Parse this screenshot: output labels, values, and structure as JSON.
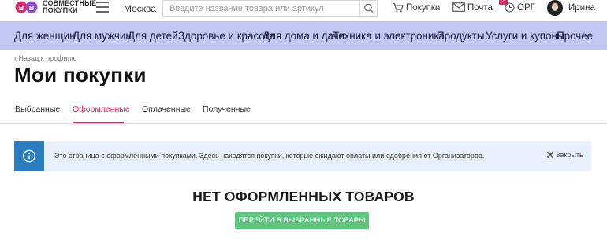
{
  "header": {
    "logo_line1": "СОВМЕСТНЫЕ",
    "logo_line2": "ПОКУПКИ",
    "city": "Москва",
    "search_placeholder": "Введите название товара или артикул",
    "links": {
      "purchases": "Покупки",
      "mail": "Почта",
      "org": "ОРГ",
      "org_badge": "2",
      "user": "Ирина"
    },
    "icons": {
      "logo": "sp-logo-icon",
      "menu": "menu-icon",
      "search": "search-icon",
      "cart": "cart-icon",
      "mail": "mail-icon",
      "org": "clock-icon"
    }
  },
  "categories": [
    "Для женщин",
    "Для мужчин",
    "Для детей",
    "Здоровье и красота",
    "Для дома и дачи",
    "Техника и электроника",
    "Продукты",
    "Услуги и купоны",
    "Прочее"
  ],
  "page": {
    "back_link": "Назад к профилю",
    "title": "Мои покупки"
  },
  "tabs": [
    {
      "label": "Выбранные",
      "active": false
    },
    {
      "label": "Оформленные",
      "active": true
    },
    {
      "label": "Оплаченные",
      "active": false
    },
    {
      "label": "Полученные",
      "active": false
    }
  ],
  "alert": {
    "icon": "info-icon",
    "text": "Это страница с оформленными покупками. Здесь находятся покупки, которые ожидают оплаты или одобрения от Организаторов.",
    "close_label": "Закрыть"
  },
  "empty_state": {
    "title": "НЕТ ОФОРМЛЕННЫХ ТОВАРОВ",
    "button_label": "ПЕРЕЙТИ В ВЫБРАННЫЕ ТОВАРЫ"
  },
  "colors": {
    "accent": "#e3256b",
    "category_bar": "#c2c7f4",
    "info_blue": "#2a7ebf",
    "alert_bg": "#e8f1fb",
    "primary_button": "#5cc57e"
  }
}
